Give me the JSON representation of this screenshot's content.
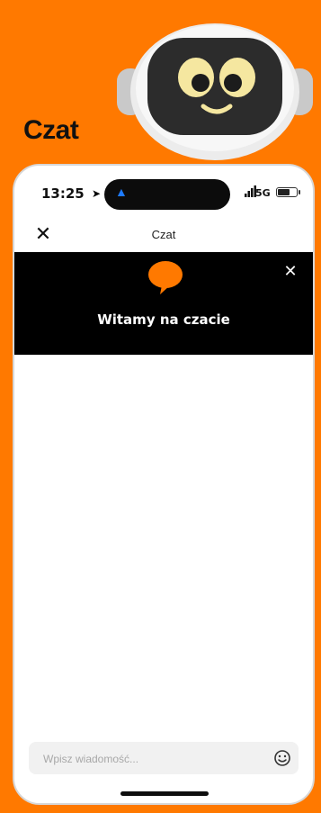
{
  "page": {
    "heading": "Czat",
    "accent_color": "#ff7900"
  },
  "mascot": {
    "icon": "robot-mascot-icon"
  },
  "status_bar": {
    "time": "13:25",
    "location_icon": "location-arrow-icon",
    "island_icon": "navigation-arrow-icon",
    "network": "5G",
    "battery_level": 0.7
  },
  "nav": {
    "close_icon": "close-icon",
    "title": "Czat"
  },
  "banner": {
    "icon": "chat-bubble-icon",
    "title": "Witamy na czacie",
    "close_icon": "close-icon",
    "bubble_color": "#ff7900"
  },
  "composer": {
    "placeholder": "Wpisz wiadomość...",
    "value": "",
    "emoji_icon": "emoji-icon"
  }
}
